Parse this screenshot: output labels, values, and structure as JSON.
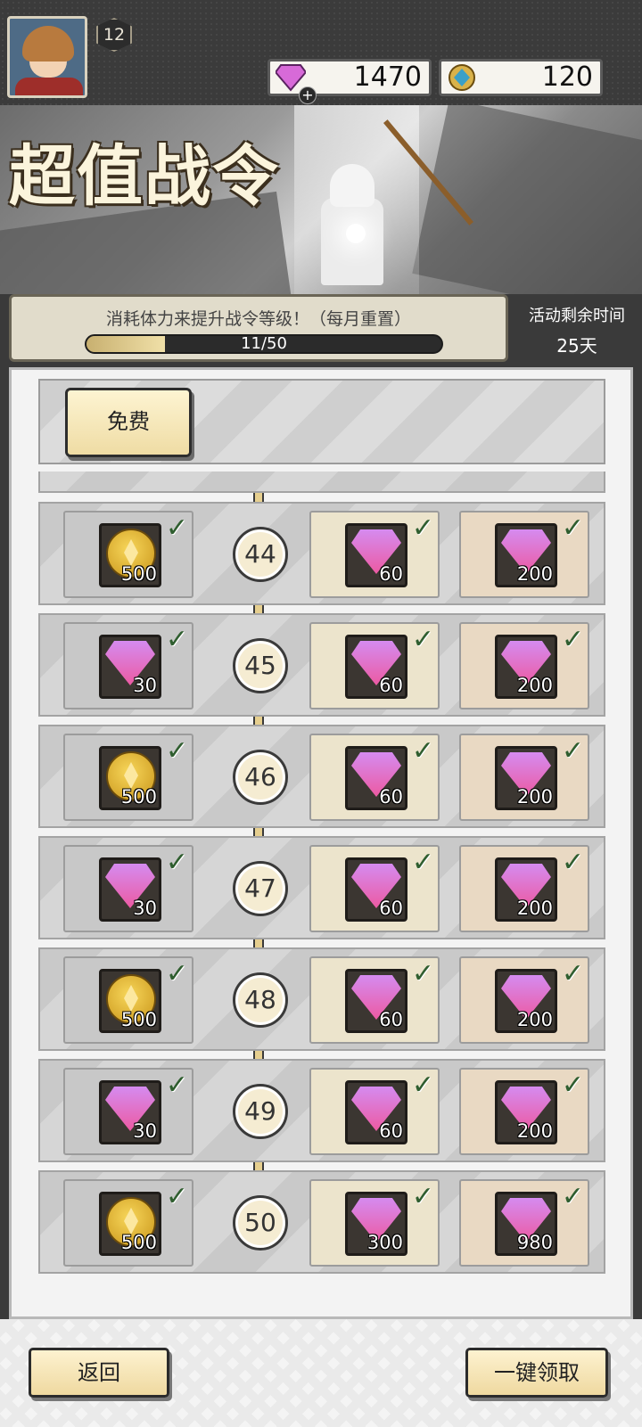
{
  "player": {
    "level": "12"
  },
  "currencies": {
    "gems": "1470",
    "tokens": "120"
  },
  "banner": {
    "title": "超值战令"
  },
  "progress": {
    "hint": "消耗体力来提升战令等级！（每月重置）",
    "label": "11/50",
    "fraction": 0.22
  },
  "event": {
    "remaining_label": "活动剩余时间",
    "remaining_value": "25天"
  },
  "tiers": {
    "free_label": "免费"
  },
  "rows": [
    {
      "level": "44",
      "free": {
        "icon": "coin",
        "qty": "500"
      },
      "p1": {
        "qty": "60"
      },
      "p2": {
        "qty": "200"
      }
    },
    {
      "level": "45",
      "free": {
        "icon": "gem",
        "qty": "30"
      },
      "p1": {
        "qty": "60"
      },
      "p2": {
        "qty": "200"
      }
    },
    {
      "level": "46",
      "free": {
        "icon": "coin",
        "qty": "500"
      },
      "p1": {
        "qty": "60"
      },
      "p2": {
        "qty": "200"
      }
    },
    {
      "level": "47",
      "free": {
        "icon": "gem",
        "qty": "30"
      },
      "p1": {
        "qty": "60"
      },
      "p2": {
        "qty": "200"
      }
    },
    {
      "level": "48",
      "free": {
        "icon": "coin",
        "qty": "500"
      },
      "p1": {
        "qty": "60"
      },
      "p2": {
        "qty": "200"
      }
    },
    {
      "level": "49",
      "free": {
        "icon": "gem",
        "qty": "30"
      },
      "p1": {
        "qty": "60"
      },
      "p2": {
        "qty": "200"
      }
    },
    {
      "level": "50",
      "free": {
        "icon": "coin",
        "qty": "500"
      },
      "p1": {
        "qty": "300"
      },
      "p2": {
        "qty": "980"
      }
    }
  ],
  "buttons": {
    "back": "返回",
    "claim_all": "一键领取"
  }
}
